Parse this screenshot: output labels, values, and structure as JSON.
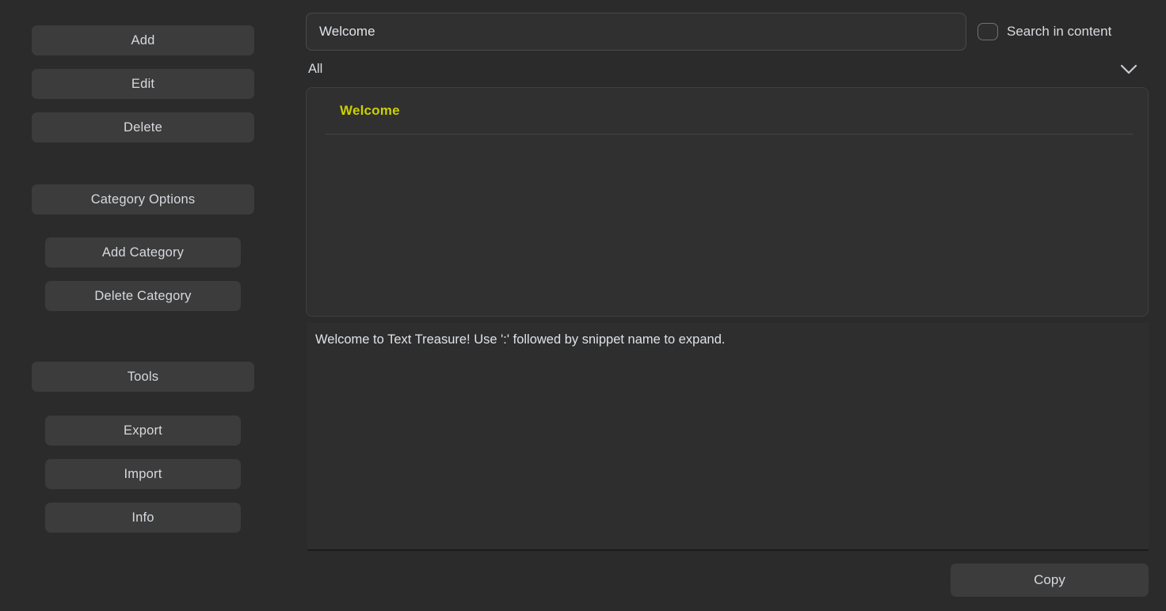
{
  "window": {
    "background_color": "#2b2b2b",
    "button_color": "#3c3c3c",
    "accent_color": "#ccd000",
    "text_color": "#d6d9de"
  },
  "sidebar": {
    "snippet_actions": [
      {
        "label": "Add",
        "name": "add-button"
      },
      {
        "label": "Edit",
        "name": "edit-button"
      },
      {
        "label": "Delete",
        "name": "delete-button"
      }
    ],
    "category_section": {
      "header_label": "Category Options",
      "actions": [
        {
          "label": "Add Category",
          "name": "add-category-button"
        },
        {
          "label": "Delete Category",
          "name": "delete-category-button"
        }
      ]
    },
    "tools_section": {
      "header_label": "Tools",
      "actions": [
        {
          "label": "Export",
          "name": "export-button"
        },
        {
          "label": "Import",
          "name": "import-button"
        },
        {
          "label": "Info",
          "name": "info-button"
        }
      ]
    }
  },
  "search": {
    "value": "Welcome",
    "placeholder": "Search snippets...",
    "search_in_content": {
      "label": "Search in content",
      "checked": false
    }
  },
  "category_filter": {
    "selected": "All",
    "options": [
      "All"
    ],
    "chevron_icon": "chevron-down-icon"
  },
  "snippet_list": {
    "items": [
      {
        "name": "Welcome"
      }
    ]
  },
  "content": {
    "text": "Welcome to Text Treasure! Use ':' followed by snippet name to expand.",
    "placeholder": "Snippet content"
  },
  "footer": {
    "copy_label": "Copy"
  }
}
